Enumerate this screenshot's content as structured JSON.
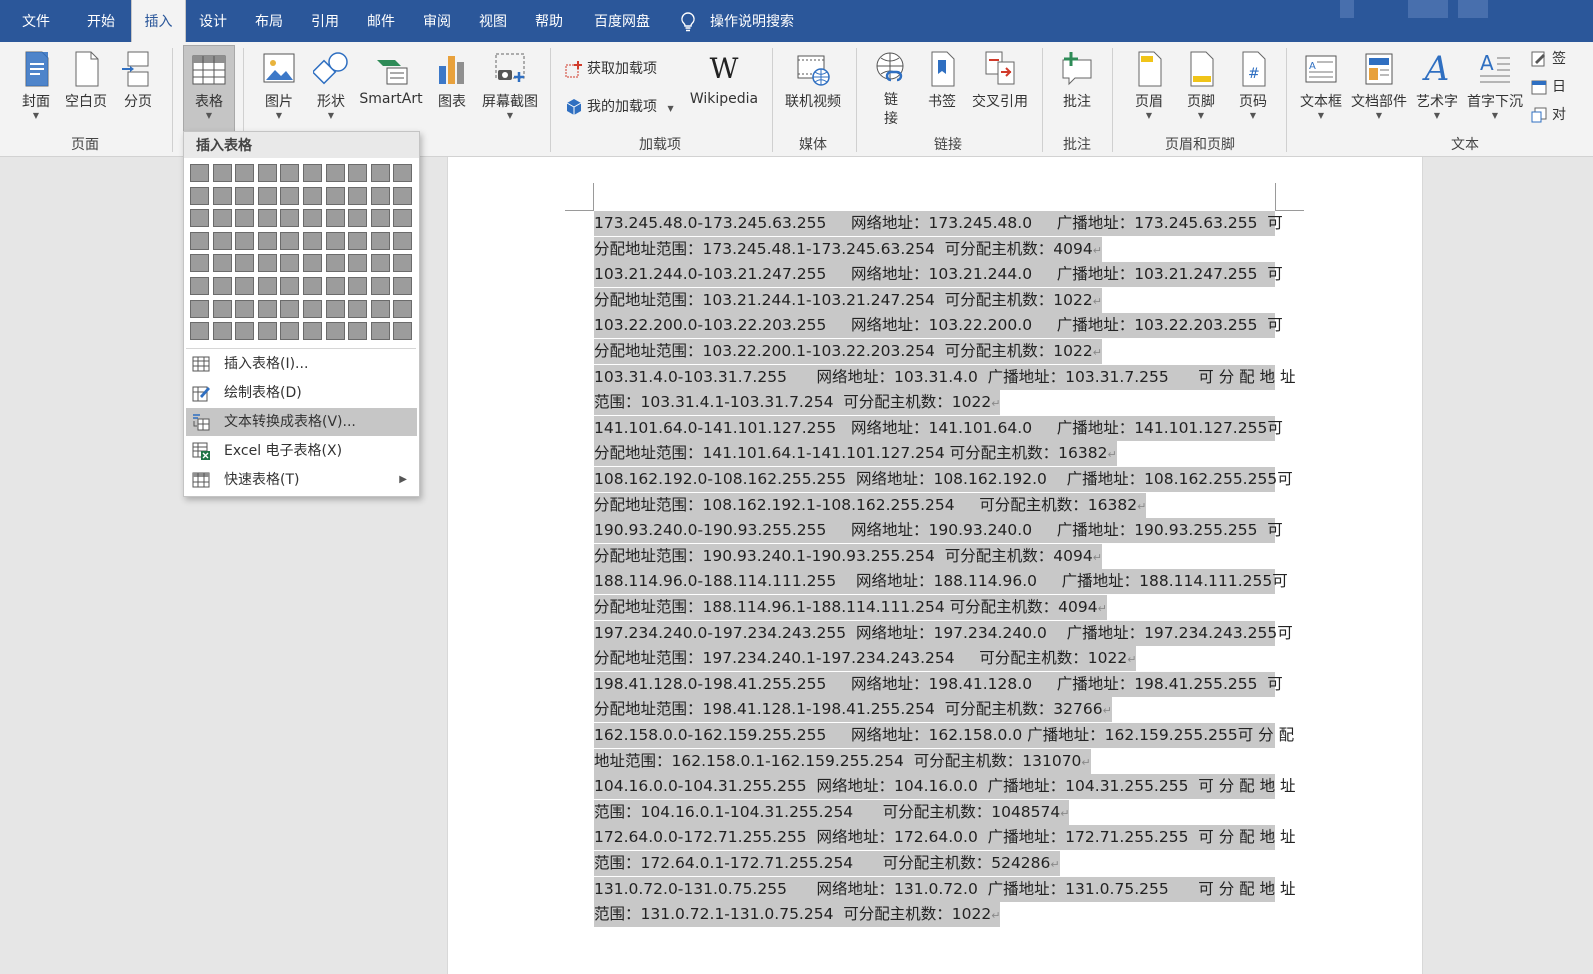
{
  "menu": {
    "tabs": [
      "文件",
      "开始",
      "插入",
      "设计",
      "布局",
      "引用",
      "邮件",
      "审阅",
      "视图",
      "帮助",
      "百度网盘"
    ],
    "active_tab": "插入",
    "search_label": "操作说明搜索"
  },
  "ribbon": {
    "pages": {
      "cover": "封面",
      "blank": "空白页",
      "page_break": "分页",
      "group": "页面"
    },
    "tables": {
      "table": "表格"
    },
    "illustrations": {
      "picture": "图片",
      "shapes": "形状",
      "smartart": "SmartArt",
      "chart": "图表",
      "screenshot": "屏幕截图"
    },
    "addins": {
      "get": "获取加载项",
      "mine": "我的加载项",
      "wikipedia": "Wikipedia",
      "group": "加载项"
    },
    "media": {
      "online_video": "联机视频",
      "group": "媒体"
    },
    "links": {
      "link": "链接",
      "bookmark": "书签",
      "cross_ref": "交叉引用",
      "group": "链接"
    },
    "comments": {
      "comment": "批注",
      "group": "批注"
    },
    "header_footer": {
      "header": "页眉",
      "footer": "页脚",
      "page_number": "页码",
      "group": "页眉和页脚"
    },
    "text": {
      "textbox": "文本框",
      "quick_parts": "文档部件",
      "wordart": "艺术字",
      "dropcap": "首字下沉",
      "sig": "签",
      "date": "日",
      "obj": "对",
      "group": "文本"
    }
  },
  "dropdown": {
    "title": "插入表格",
    "items": [
      {
        "label": "插入表格(I)...",
        "icon": "table-icon"
      },
      {
        "label": "绘制表格(D)",
        "icon": "pencil-table-icon"
      },
      {
        "label": "文本转换成表格(V)...",
        "icon": "convert-table-icon"
      },
      {
        "label": "Excel 电子表格(X)",
        "icon": "excel-icon"
      },
      {
        "label": "快速表格(T)",
        "icon": "quick-table-icon"
      }
    ],
    "highlighted_item": "文本转换成表格(V)..."
  },
  "document": {
    "lines": [
      "173.245.48.0-173.245.63.255     网络地址：173.245.48.0     广播地址：173.245.63.255  可",
      "分配地址范围：173.245.48.1-173.245.63.254  可分配主机数：4094",
      "103.21.244.0-103.21.247.255     网络地址：103.21.244.0     广播地址：103.21.247.255  可",
      "分配地址范围：103.21.244.1-103.21.247.254  可分配主机数：1022",
      "103.22.200.0-103.22.203.255     网络地址：103.22.200.0     广播地址：103.22.203.255  可",
      "分配地址范围：103.22.200.1-103.22.203.254  可分配主机数：1022",
      "103.31.4.0-103.31.7.255      网络地址：103.31.4.0  广播地址：103.31.7.255      可 分 配 地 址",
      "范围：103.31.4.1-103.31.7.254  可分配主机数：1022",
      "141.101.64.0-141.101.127.255   网络地址：141.101.64.0     广播地址：141.101.127.255可",
      "分配地址范围：141.101.64.1-141.101.127.254 可分配主机数：16382",
      "108.162.192.0-108.162.255.255  网络地址：108.162.192.0    广播地址：108.162.255.255可",
      "分配地址范围：108.162.192.1-108.162.255.254     可分配主机数：16382",
      "190.93.240.0-190.93.255.255     网络地址：190.93.240.0     广播地址：190.93.255.255  可",
      "分配地址范围：190.93.240.1-190.93.255.254  可分配主机数：4094",
      "188.114.96.0-188.114.111.255    网络地址：188.114.96.0     广播地址：188.114.111.255可",
      "分配地址范围：188.114.96.1-188.114.111.254 可分配主机数：4094",
      "197.234.240.0-197.234.243.255  网络地址：197.234.240.0    广播地址：197.234.243.255可",
      "分配地址范围：197.234.240.1-197.234.243.254     可分配主机数：1022",
      "198.41.128.0-198.41.255.255     网络地址：198.41.128.0     广播地址：198.41.255.255  可",
      "分配地址范围：198.41.128.1-198.41.255.254  可分配主机数：32766",
      "162.158.0.0-162.159.255.255     网络地址：162.158.0.0 广播地址：162.159.255.255可 分 配",
      "地址范围：162.158.0.1-162.159.255.254  可分配主机数：131070",
      "104.16.0.0-104.31.255.255  网络地址：104.16.0.0  广播地址：104.31.255.255  可 分 配 地 址",
      "范围：104.16.0.1-104.31.255.254      可分配主机数：1048574",
      "172.64.0.0-172.71.255.255  网络地址：172.64.0.0  广播地址：172.71.255.255  可 分 配 地 址",
      "范围：172.64.0.1-172.71.255.254      可分配主机数：524286",
      "131.0.72.0-131.0.75.255      网络地址：131.0.72.0  广播地址：131.0.75.255      可 分 配 地 址",
      "范围：131.0.72.1-131.0.75.254  可分配主机数：1022"
    ],
    "paragraph_mark": "↵"
  }
}
